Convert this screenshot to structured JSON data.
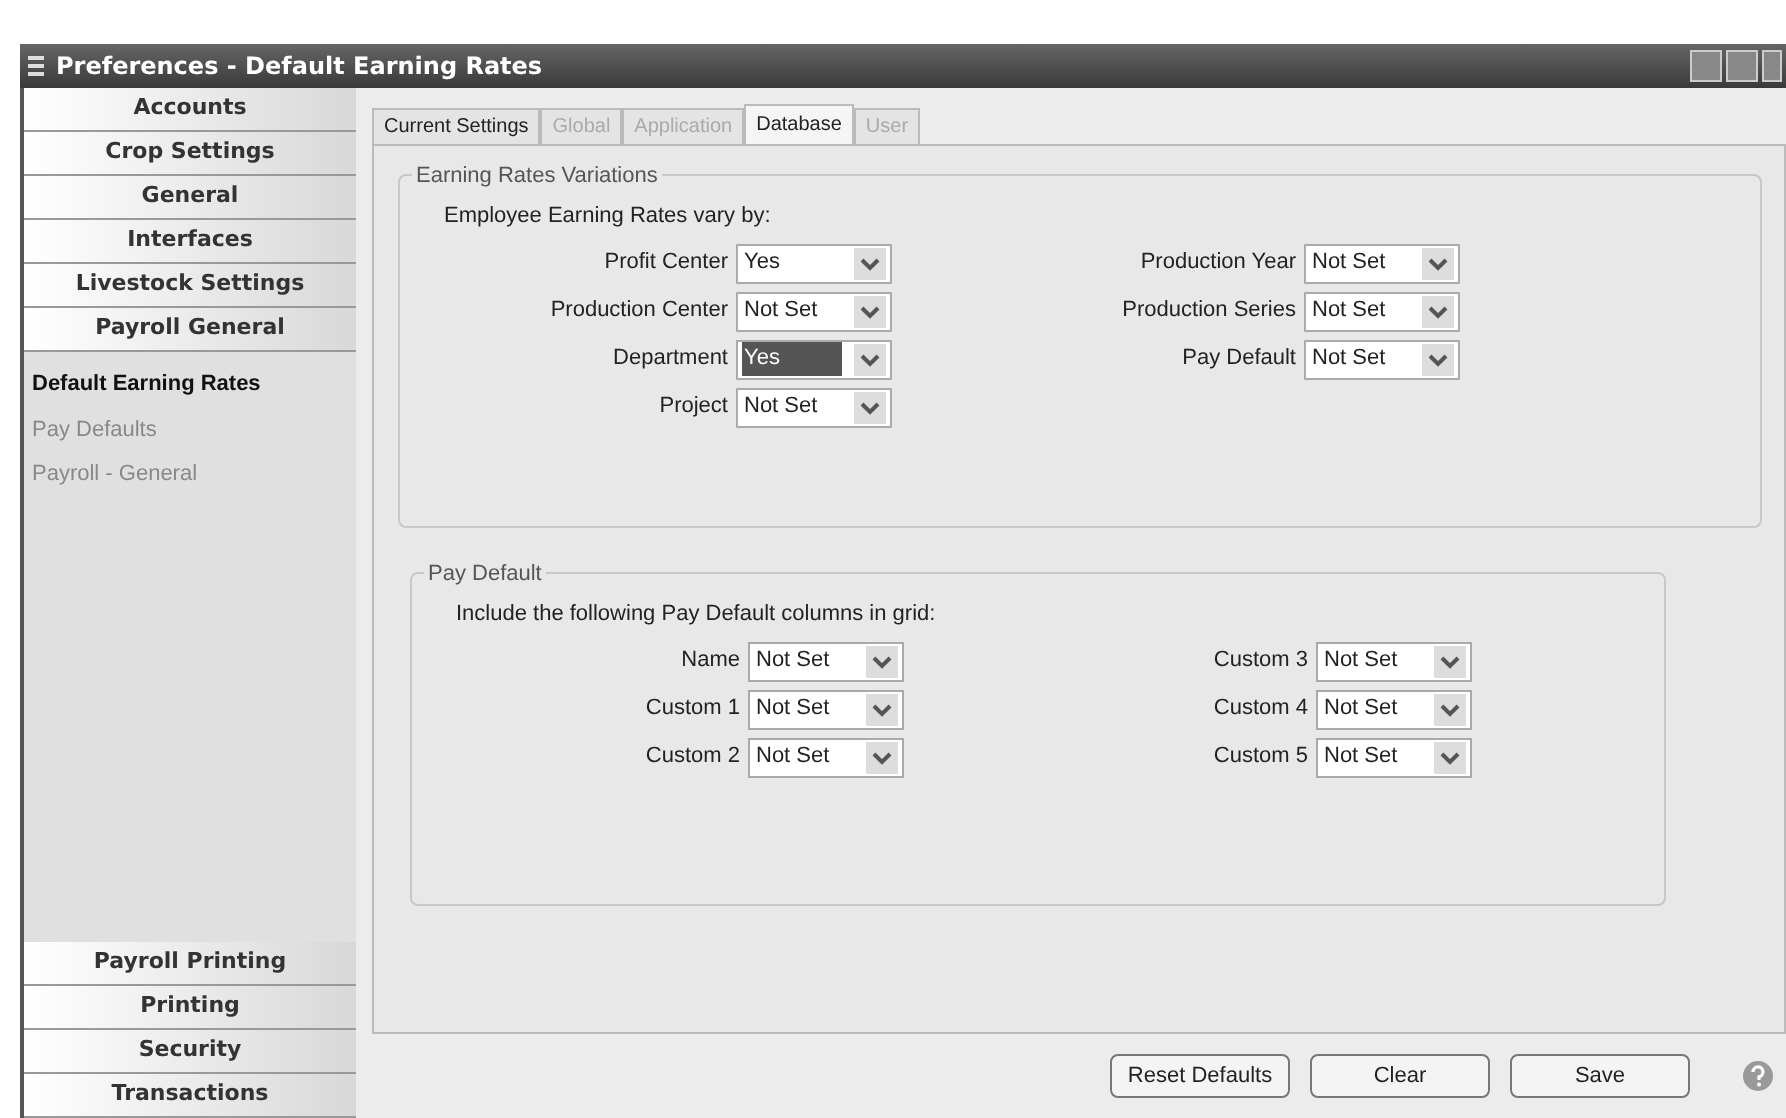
{
  "window": {
    "title": "Preferences - Default Earning Rates"
  },
  "sidebar": {
    "top_sections": [
      {
        "label": "Accounts"
      },
      {
        "label": "Crop Settings"
      },
      {
        "label": "General"
      },
      {
        "label": "Interfaces"
      },
      {
        "label": "Livestock Settings"
      },
      {
        "label": "Payroll General"
      }
    ],
    "items": [
      {
        "label": "Default Earning Rates",
        "selected": true
      },
      {
        "label": "Pay Defaults",
        "selected": false
      },
      {
        "label": "Payroll - General",
        "selected": false
      }
    ],
    "bottom_sections": [
      {
        "label": "Payroll Printing"
      },
      {
        "label": "Printing"
      },
      {
        "label": "Security"
      },
      {
        "label": "Transactions"
      }
    ]
  },
  "tabs": [
    {
      "label": "Current Settings",
      "selected": false,
      "disabled": false
    },
    {
      "label": "Global",
      "selected": false,
      "disabled": true
    },
    {
      "label": "Application",
      "selected": false,
      "disabled": true
    },
    {
      "label": "Database",
      "selected": true,
      "disabled": false
    },
    {
      "label": "User",
      "selected": false,
      "disabled": true
    }
  ],
  "earning_rates_group": {
    "title": "Earning Rates Variations",
    "intro": "Employee Earning Rates vary by:",
    "left": [
      {
        "label": "Profit Center",
        "value": "Yes",
        "highlighted": false
      },
      {
        "label": "Production Center",
        "value": "Not Set",
        "highlighted": false
      },
      {
        "label": "Department",
        "value": "Yes",
        "highlighted": true
      },
      {
        "label": "Project",
        "value": "Not Set",
        "highlighted": false
      }
    ],
    "right": [
      {
        "label": "Production Year",
        "value": "Not Set",
        "highlighted": false
      },
      {
        "label": "Production Series",
        "value": "Not Set",
        "highlighted": false
      },
      {
        "label": "Pay Default",
        "value": "Not Set",
        "highlighted": false
      }
    ]
  },
  "pay_default_group": {
    "title": "Pay Default",
    "intro": "Include the following Pay Default columns in grid:",
    "left": [
      {
        "label": "Name",
        "value": "Not Set",
        "highlighted": false
      },
      {
        "label": "Custom 1",
        "value": "Not Set",
        "highlighted": false
      },
      {
        "label": "Custom 2",
        "value": "Not Set",
        "highlighted": false
      }
    ],
    "right": [
      {
        "label": "Custom 3",
        "value": "Not Set",
        "highlighted": false
      },
      {
        "label": "Custom 4",
        "value": "Not Set",
        "highlighted": false
      },
      {
        "label": "Custom 5",
        "value": "Not Set",
        "highlighted": false
      }
    ]
  },
  "buttons": [
    {
      "label": "Reset Defaults"
    },
    {
      "label": "Clear"
    },
    {
      "label": "Save"
    }
  ]
}
